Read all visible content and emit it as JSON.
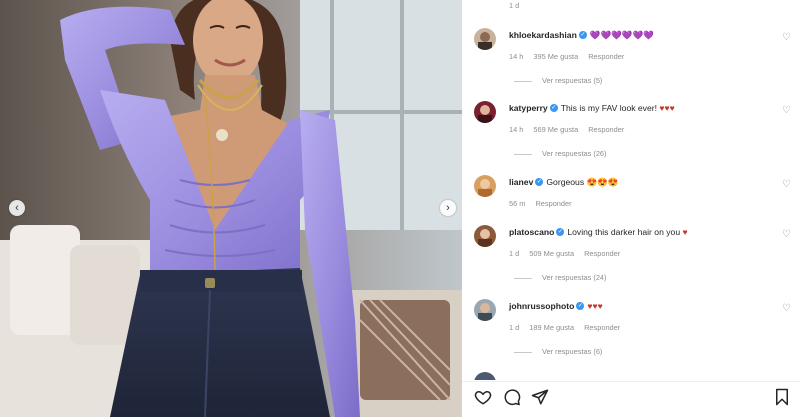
{
  "top_time": "1 d",
  "comments": [
    {
      "user": "khloekardashian",
      "verified": true,
      "text": "💜💜💜💜💜💜",
      "meta": [
        "14 h",
        "395 Me gusta",
        "Responder"
      ],
      "replies": "Ver respuestas (5)"
    },
    {
      "user": "katyperry",
      "verified": true,
      "text": "This is my FAV look ever! ♥♥♥",
      "meta": [
        "14 h",
        "569 Me gusta",
        "Responder"
      ],
      "replies": "Ver respuestas (26)"
    },
    {
      "user": "lianev",
      "verified": true,
      "text": "Gorgeous 😍😍😍",
      "meta": [
        "56 m",
        "Responder"
      ],
      "replies": ""
    },
    {
      "user": "platoscano",
      "verified": true,
      "text": "Loving this darker hair on you ♥",
      "meta": [
        "1 d",
        "509 Me gusta",
        "Responder"
      ],
      "replies": "Ver respuestas (24)"
    },
    {
      "user": "johnrussophoto",
      "verified": true,
      "text": "♥♥♥",
      "meta": [
        "1 d",
        "189 Me gusta",
        "Responder"
      ],
      "replies": "Ver respuestas (6)"
    }
  ],
  "colors": {
    "accent": "#3897f0",
    "heart_red": "#c0392b",
    "top_color": "#a79be0",
    "jeans": "#2b3345"
  },
  "icons": [
    "heart-icon",
    "comment-icon",
    "share-icon",
    "bookmark-icon",
    "chevron-left-icon",
    "chevron-right-icon"
  ]
}
